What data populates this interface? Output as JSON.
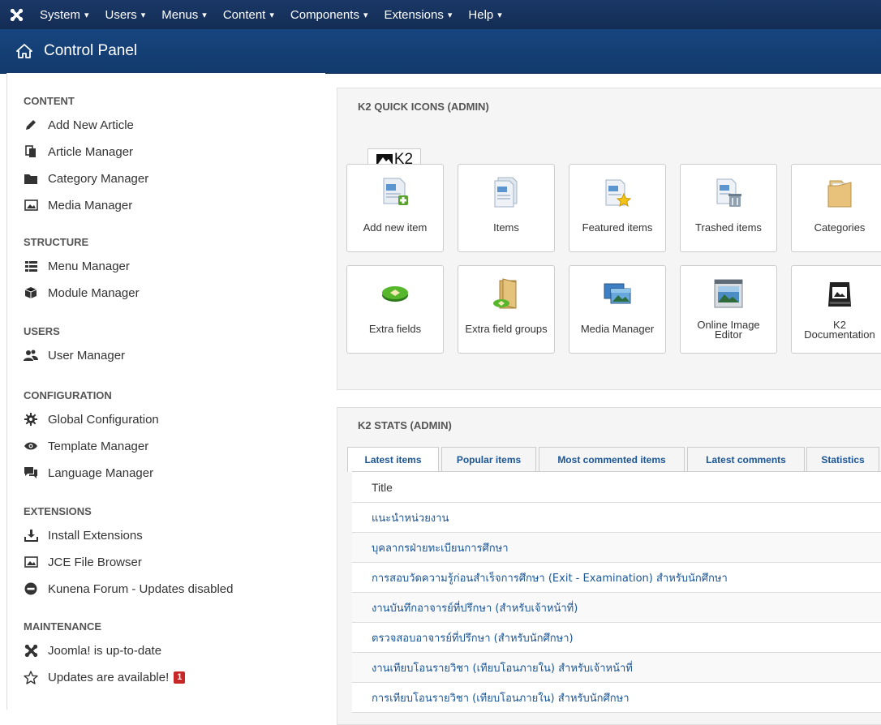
{
  "topbar": {
    "menus": [
      {
        "label": "System"
      },
      {
        "label": "Users"
      },
      {
        "label": "Menus"
      },
      {
        "label": "Content"
      },
      {
        "label": "Components"
      },
      {
        "label": "Extensions"
      },
      {
        "label": "Help"
      }
    ],
    "caret": "▾"
  },
  "titlebar": {
    "title": "Control Panel"
  },
  "sidebar": {
    "sections": [
      {
        "title": "CONTENT",
        "items": [
          {
            "label": "Add New Article",
            "icon": "pencil-icon"
          },
          {
            "label": "Article Manager",
            "icon": "copy-icon"
          },
          {
            "label": "Category Manager",
            "icon": "folder-icon"
          },
          {
            "label": "Media Manager",
            "icon": "image-icon"
          }
        ]
      },
      {
        "title": "STRUCTURE",
        "items": [
          {
            "label": "Menu Manager",
            "icon": "list-icon"
          },
          {
            "label": "Module Manager",
            "icon": "cube-icon"
          }
        ]
      },
      {
        "title": "USERS",
        "items": [
          {
            "label": "User Manager",
            "icon": "users-icon"
          }
        ]
      },
      {
        "title": "CONFIGURATION",
        "items": [
          {
            "label": "Global Configuration",
            "icon": "cog-icon"
          },
          {
            "label": "Template Manager",
            "icon": "eye-icon"
          },
          {
            "label": "Language Manager",
            "icon": "comments-icon"
          }
        ]
      },
      {
        "title": "EXTENSIONS",
        "items": [
          {
            "label": "Install Extensions",
            "icon": "download-icon"
          },
          {
            "label": "JCE File Browser",
            "icon": "image-icon"
          },
          {
            "label": "Kunena Forum - Updates disabled",
            "icon": "minus-circle-icon"
          }
        ]
      },
      {
        "title": "MAINTENANCE",
        "items": [
          {
            "label": "Joomla! is up-to-date",
            "icon": "joomla-icon"
          },
          {
            "label": "Updates are available!",
            "icon": "star-icon",
            "badge": "1"
          }
        ]
      }
    ]
  },
  "quickicons": {
    "title": "K2 QUICK ICONS (ADMIN)",
    "tab": "K2",
    "items": [
      {
        "label": "Add new item",
        "icon": "add-item-icon"
      },
      {
        "label": "Items",
        "icon": "items-icon"
      },
      {
        "label": "Featured items",
        "icon": "featured-items-icon"
      },
      {
        "label": "Trashed items",
        "icon": "trashed-items-icon"
      },
      {
        "label": "Categories",
        "icon": "categories-icon"
      },
      {
        "label": "Extra fields",
        "icon": "extra-fields-icon"
      },
      {
        "label": "Extra field groups",
        "icon": "extra-field-groups-icon"
      },
      {
        "label": "Media Manager",
        "icon": "media-manager-icon"
      },
      {
        "label": "Online Image\nEditor",
        "icon": "image-editor-icon"
      },
      {
        "label": "K2\nDocumentation",
        "icon": "documentation-icon"
      }
    ]
  },
  "stats": {
    "title": "K2 STATS (ADMIN)",
    "tabs": [
      {
        "label": "Latest items"
      },
      {
        "label": "Popular items"
      },
      {
        "label": "Most commented items"
      },
      {
        "label": "Latest comments"
      },
      {
        "label": "Statistics"
      }
    ],
    "table": {
      "header": "Title",
      "rows": [
        "แนะนำหน่วยงาน",
        "บุคลากรฝ่ายทะเบียนการศึกษา",
        "การสอบวัดความรู้ก่อนสำเร็จการศึกษา (Exit - Examination) สำหรับนักศึกษา",
        "งานบันทึกอาจารย์ที่ปรึกษา (สำหรับเจ้าหน้าที่)",
        "ตรวจสอบอาจารย์ที่ปรึกษา (สำหรับนักศึกษา)",
        "งานเทียบโอนรายวิชา (เทียบโอนภายใน) สำหรับเจ้าหน้าที่",
        "การเทียบโอนรายวิชา (เทียบโอนภายใน) สำหรับนักศึกษา"
      ]
    }
  },
  "colors": {
    "navbar": "#1a3867",
    "titlebar": "#17457f",
    "link": "#1a5596",
    "badge": "#c52827"
  }
}
